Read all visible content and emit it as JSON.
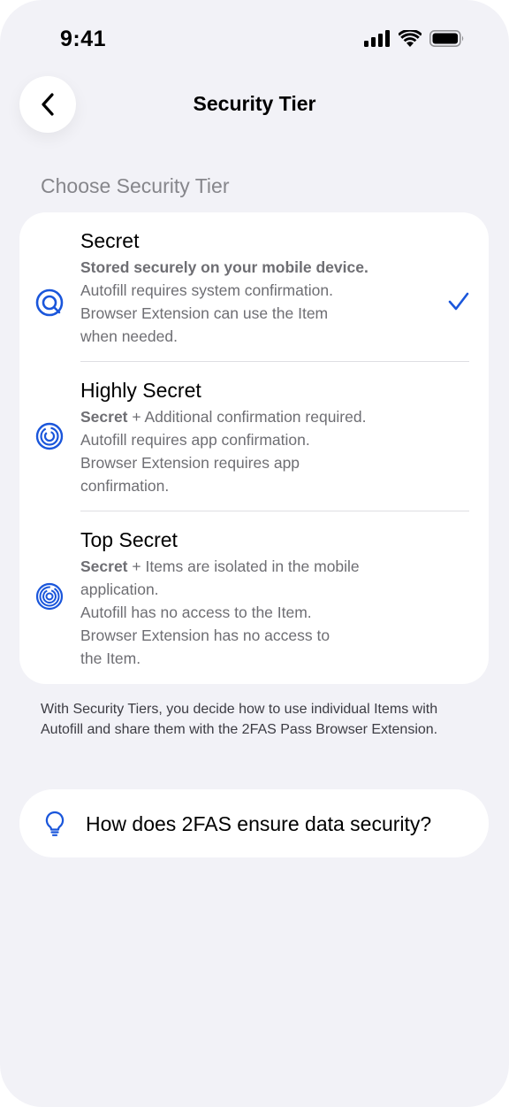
{
  "status_bar": {
    "time": "9:41"
  },
  "nav": {
    "title": "Security Tier"
  },
  "section_header": "Choose Security Tier",
  "tiers": [
    {
      "title": "Secret",
      "lead": "Stored securely on your mobile device.",
      "lines": [
        "Autofill requires system confirmation.",
        "Browser Extension can use the Item",
        "when needed."
      ],
      "selected": true,
      "icon": "secret-tier-icon"
    },
    {
      "title": "Highly Secret",
      "lead": "Secret",
      "lead_rest": " + Additional confirmation required.",
      "lines": [
        "Autofill requires app confirmation.",
        "Browser Extension requires app",
        "confirmation."
      ],
      "selected": false,
      "icon": "highly-secret-tier-icon"
    },
    {
      "title": "Top Secret",
      "lead": "Secret",
      "lead_rest": " + Items are isolated in the mobile",
      "lines": [
        "application.",
        "Autofill has no access to the Item.",
        "Browser Extension has no access to",
        "the Item."
      ],
      "selected": false,
      "icon": "top-secret-tier-icon"
    }
  ],
  "footnote": "With Security Tiers, you decide how to use individual Items with Autofill and share them with the 2FAS Pass Browser Extension.",
  "info_link": {
    "label": "How does 2FAS ensure data security?",
    "icon": "lightbulb-icon"
  },
  "colors": {
    "accent": "#1a56db",
    "background": "#f2f2f7",
    "card": "#ffffff",
    "secondary_text": "#6e6e73"
  }
}
